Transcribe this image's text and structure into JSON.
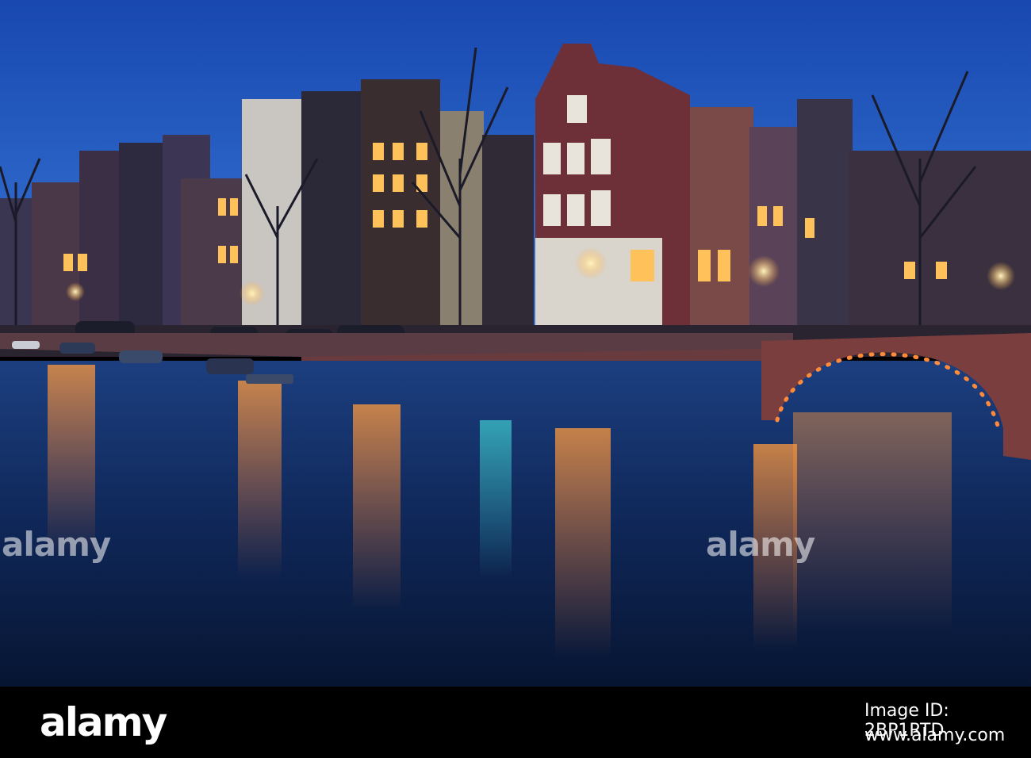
{
  "watermarks": [
    "alamy",
    "alamy"
  ],
  "footer": {
    "logo": "alamy",
    "image_id": "Image ID: 2BP1RTD",
    "url": "www.alamy.com"
  },
  "colors": {
    "sky_top": "#1a4fb8",
    "sky_bottom": "#2e6fd0",
    "water": "#0d2550",
    "bridge": "#7a3b3a",
    "window_glow": "#ffb347",
    "footer_bg": "#000000"
  }
}
